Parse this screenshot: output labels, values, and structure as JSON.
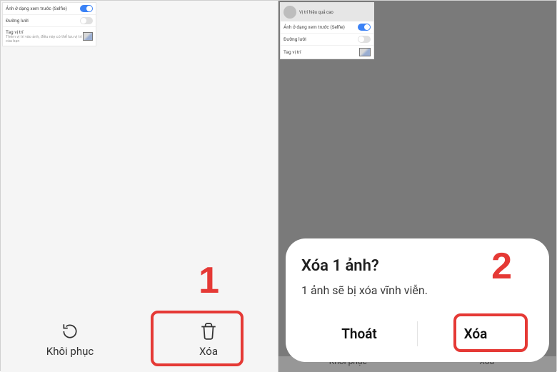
{
  "pane1": {
    "mini": {
      "row1": "Ảnh ở dạng xem trước (Selfie)",
      "row2": "Đường lưới",
      "row3": "Tag vị trí",
      "row3_sub": "Thêm vị trí vào ảnh, điều này có thể lưu vị trí của bạn"
    },
    "actions": {
      "restore_label": "Khôi phục",
      "delete_label": "Xóa"
    },
    "step": "1"
  },
  "pane2": {
    "mini": {
      "head_title": "Vị trí hiệu quả cao",
      "row1": "Ảnh ở dạng xem trước (Selfie)",
      "row2": "Đường lưới",
      "row3": "Tag vị trí"
    },
    "ghost": {
      "restore": "Khôi phục",
      "delete": "Xóa"
    },
    "dialog": {
      "title": "Xóa 1 ảnh?",
      "message": "1 ảnh sẽ bị xóa vĩnh viễn.",
      "cancel": "Thoát",
      "confirm": "Xóa"
    },
    "step": "2"
  }
}
